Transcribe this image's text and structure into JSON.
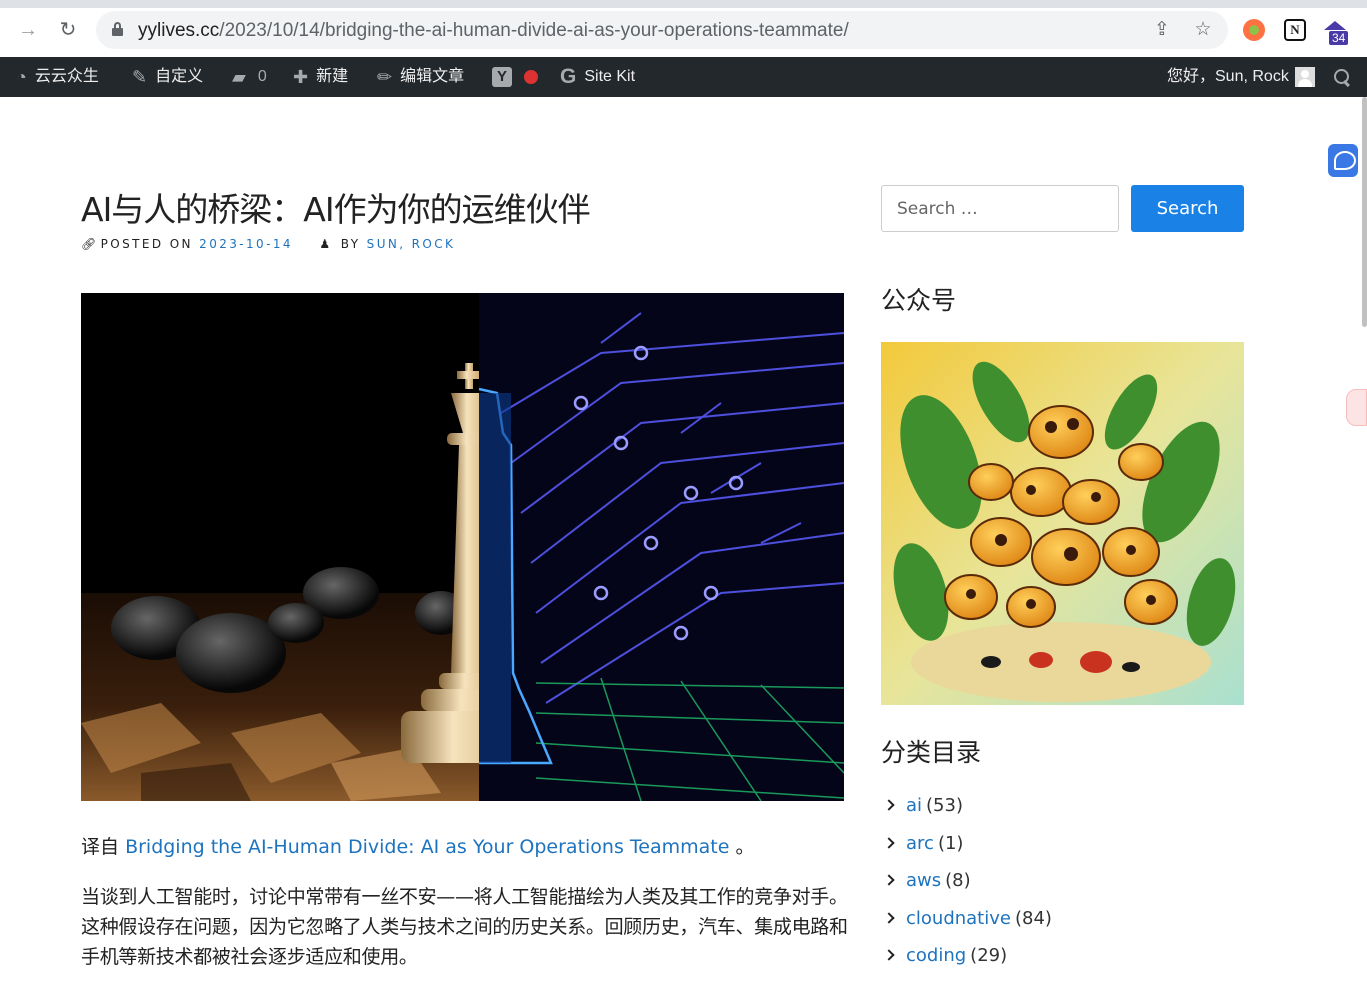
{
  "browser": {
    "url_host": "yylives.cc",
    "url_path": "/2023/10/14/bridging-the-ai-human-divide-ai-as-your-operations-teammate/",
    "extension_badge": "34"
  },
  "adminbar": {
    "site_name": "云云众生",
    "customize": "自定义",
    "comments_count": "0",
    "new": "新建",
    "edit_post": "编辑文章",
    "yoast": "Y",
    "sitekit": "Site Kit",
    "howdy": "您好，Sun, Rock"
  },
  "post": {
    "title": "AI与人的桥梁：AI作为你的运维伙伴",
    "posted_on_label": "POSTED ON",
    "date": "2023-10-14",
    "by_label": "BY",
    "author": "SUN, ROCK",
    "translated_from_prefix": "译自",
    "source_link_text": "Bridging the AI-Human Divide: AI as Your Operations Teammate",
    "translated_from_suffix": "。",
    "paragraph": "当谈到人工智能时，讨论中常带有一丝不安——将人工智能描绘为人类及其工作的竞争对手。这种假设存在问题，因为它忽略了人类与技术之间的历史关系。回顾历史，汽车、集成电路和手机等新技术都被社会逐步适应和使用。"
  },
  "sidebar": {
    "search_placeholder": "Search …",
    "search_button": "Search",
    "wechat_title": "公众号",
    "categories_title": "分类目录",
    "categories": [
      {
        "name": "ai",
        "count": "(53)"
      },
      {
        "name": "arc",
        "count": "(1)"
      },
      {
        "name": "aws",
        "count": "(8)"
      },
      {
        "name": "cloudnative",
        "count": "(84)"
      },
      {
        "name": "coding",
        "count": "(29)"
      }
    ]
  },
  "colors": {
    "link": "#1e73be",
    "adminbar_bg": "#23282d",
    "search_button_bg": "#1a82e6"
  }
}
